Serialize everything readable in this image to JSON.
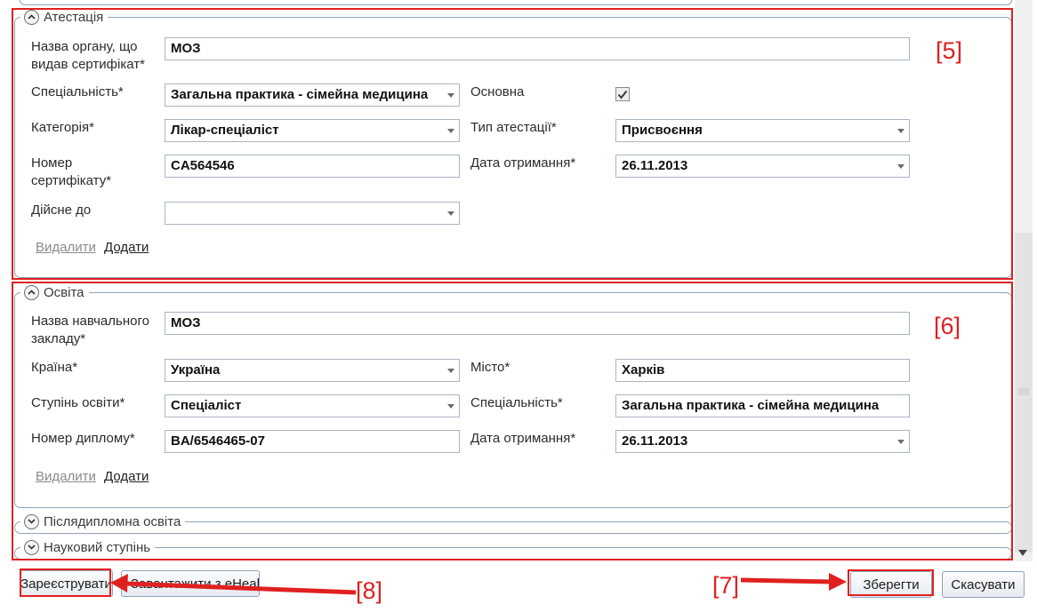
{
  "attestation": {
    "title": "Атестація",
    "labels": {
      "issuer": "Назва органу, що видав сертифікат*",
      "specialty": "Спеціальність*",
      "primary": "Основна",
      "category": "Категорія*",
      "type": "Тип атестації*",
      "cert_number": "Номер сертифікату*",
      "received": "Дата отримання*",
      "valid_until": "Дійсне до"
    },
    "values": {
      "issuer": "МОЗ",
      "specialty": "Загальна практика - сімейна медицина",
      "primary_checked": true,
      "category": "Лікар-спеціаліст",
      "type": "Присвоєння",
      "cert_number": "CA564546",
      "received": "26.11.2013",
      "valid_until": ""
    },
    "delete_label": "Видалити",
    "add_label": "Додати"
  },
  "education": {
    "title": "Освіта",
    "labels": {
      "institution": "Назва навчального закладу*",
      "country": "Країна*",
      "city": "Місто*",
      "degree": "Ступінь освіти*",
      "specialty": "Спеціальність*",
      "diploma": "Номер диплому*",
      "received": "Дата отримання*"
    },
    "values": {
      "institution": "МОЗ",
      "country": "Україна",
      "city": "Харків",
      "degree": "Спеціаліст",
      "specialty": "Загальна практика - сімейна медицина",
      "diploma": "BA/6546465-07",
      "received": "26.11.2013"
    },
    "delete_label": "Видалити",
    "add_label": "Додати"
  },
  "postgrad": {
    "title": "Післядипломна освіта"
  },
  "science": {
    "title": "Науковий ступінь"
  },
  "buttons": {
    "register": "Зареєструвати",
    "load_ehealth": "Завантажити з eHealth",
    "save": "Зберегти",
    "cancel": "Скасувати"
  },
  "annotations": {
    "n5": "[5]",
    "n6": "[6]",
    "n7": "[7]",
    "n8": "[8]"
  },
  "colors": {
    "annotation_red": "#e02020",
    "group_border": "#8fa3ba"
  }
}
